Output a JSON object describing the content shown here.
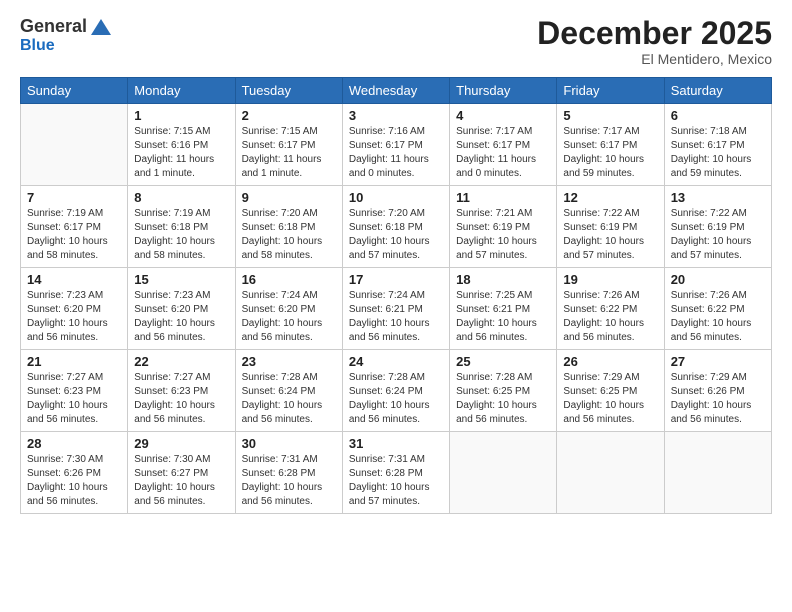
{
  "logo": {
    "general": "General",
    "blue": "Blue"
  },
  "header": {
    "month": "December 2025",
    "location": "El Mentidero, Mexico"
  },
  "weekdays": [
    "Sunday",
    "Monday",
    "Tuesday",
    "Wednesday",
    "Thursday",
    "Friday",
    "Saturday"
  ],
  "weeks": [
    [
      {
        "day": "",
        "info": ""
      },
      {
        "day": "1",
        "info": "Sunrise: 7:15 AM\nSunset: 6:16 PM\nDaylight: 11 hours\nand 1 minute."
      },
      {
        "day": "2",
        "info": "Sunrise: 7:15 AM\nSunset: 6:17 PM\nDaylight: 11 hours\nand 1 minute."
      },
      {
        "day": "3",
        "info": "Sunrise: 7:16 AM\nSunset: 6:17 PM\nDaylight: 11 hours\nand 0 minutes."
      },
      {
        "day": "4",
        "info": "Sunrise: 7:17 AM\nSunset: 6:17 PM\nDaylight: 11 hours\nand 0 minutes."
      },
      {
        "day": "5",
        "info": "Sunrise: 7:17 AM\nSunset: 6:17 PM\nDaylight: 10 hours\nand 59 minutes."
      },
      {
        "day": "6",
        "info": "Sunrise: 7:18 AM\nSunset: 6:17 PM\nDaylight: 10 hours\nand 59 minutes."
      }
    ],
    [
      {
        "day": "7",
        "info": "Sunrise: 7:19 AM\nSunset: 6:17 PM\nDaylight: 10 hours\nand 58 minutes."
      },
      {
        "day": "8",
        "info": "Sunrise: 7:19 AM\nSunset: 6:18 PM\nDaylight: 10 hours\nand 58 minutes."
      },
      {
        "day": "9",
        "info": "Sunrise: 7:20 AM\nSunset: 6:18 PM\nDaylight: 10 hours\nand 58 minutes."
      },
      {
        "day": "10",
        "info": "Sunrise: 7:20 AM\nSunset: 6:18 PM\nDaylight: 10 hours\nand 57 minutes."
      },
      {
        "day": "11",
        "info": "Sunrise: 7:21 AM\nSunset: 6:19 PM\nDaylight: 10 hours\nand 57 minutes."
      },
      {
        "day": "12",
        "info": "Sunrise: 7:22 AM\nSunset: 6:19 PM\nDaylight: 10 hours\nand 57 minutes."
      },
      {
        "day": "13",
        "info": "Sunrise: 7:22 AM\nSunset: 6:19 PM\nDaylight: 10 hours\nand 57 minutes."
      }
    ],
    [
      {
        "day": "14",
        "info": "Sunrise: 7:23 AM\nSunset: 6:20 PM\nDaylight: 10 hours\nand 56 minutes."
      },
      {
        "day": "15",
        "info": "Sunrise: 7:23 AM\nSunset: 6:20 PM\nDaylight: 10 hours\nand 56 minutes."
      },
      {
        "day": "16",
        "info": "Sunrise: 7:24 AM\nSunset: 6:20 PM\nDaylight: 10 hours\nand 56 minutes."
      },
      {
        "day": "17",
        "info": "Sunrise: 7:24 AM\nSunset: 6:21 PM\nDaylight: 10 hours\nand 56 minutes."
      },
      {
        "day": "18",
        "info": "Sunrise: 7:25 AM\nSunset: 6:21 PM\nDaylight: 10 hours\nand 56 minutes."
      },
      {
        "day": "19",
        "info": "Sunrise: 7:26 AM\nSunset: 6:22 PM\nDaylight: 10 hours\nand 56 minutes."
      },
      {
        "day": "20",
        "info": "Sunrise: 7:26 AM\nSunset: 6:22 PM\nDaylight: 10 hours\nand 56 minutes."
      }
    ],
    [
      {
        "day": "21",
        "info": "Sunrise: 7:27 AM\nSunset: 6:23 PM\nDaylight: 10 hours\nand 56 minutes."
      },
      {
        "day": "22",
        "info": "Sunrise: 7:27 AM\nSunset: 6:23 PM\nDaylight: 10 hours\nand 56 minutes."
      },
      {
        "day": "23",
        "info": "Sunrise: 7:28 AM\nSunset: 6:24 PM\nDaylight: 10 hours\nand 56 minutes."
      },
      {
        "day": "24",
        "info": "Sunrise: 7:28 AM\nSunset: 6:24 PM\nDaylight: 10 hours\nand 56 minutes."
      },
      {
        "day": "25",
        "info": "Sunrise: 7:28 AM\nSunset: 6:25 PM\nDaylight: 10 hours\nand 56 minutes."
      },
      {
        "day": "26",
        "info": "Sunrise: 7:29 AM\nSunset: 6:25 PM\nDaylight: 10 hours\nand 56 minutes."
      },
      {
        "day": "27",
        "info": "Sunrise: 7:29 AM\nSunset: 6:26 PM\nDaylight: 10 hours\nand 56 minutes."
      }
    ],
    [
      {
        "day": "28",
        "info": "Sunrise: 7:30 AM\nSunset: 6:26 PM\nDaylight: 10 hours\nand 56 minutes."
      },
      {
        "day": "29",
        "info": "Sunrise: 7:30 AM\nSunset: 6:27 PM\nDaylight: 10 hours\nand 56 minutes."
      },
      {
        "day": "30",
        "info": "Sunrise: 7:31 AM\nSunset: 6:28 PM\nDaylight: 10 hours\nand 56 minutes."
      },
      {
        "day": "31",
        "info": "Sunrise: 7:31 AM\nSunset: 6:28 PM\nDaylight: 10 hours\nand 57 minutes."
      },
      {
        "day": "",
        "info": ""
      },
      {
        "day": "",
        "info": ""
      },
      {
        "day": "",
        "info": ""
      }
    ]
  ]
}
